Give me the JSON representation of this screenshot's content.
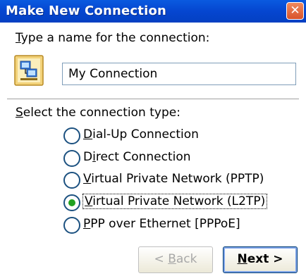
{
  "window": {
    "title": "Make New Connection",
    "close_glyph": "✕"
  },
  "name_section": {
    "prompt": "Type a name for the connection:",
    "prompt_mnemonic": "T",
    "prompt_rest": "ype a name for the connection:",
    "icon": "network-connection-icon",
    "value": "My Connection"
  },
  "type_section": {
    "prompt": "Select the connection type:",
    "prompt_mnemonic": "S",
    "prompt_rest": "elect the connection type:",
    "options": [
      {
        "label": "Dial-Up Connection",
        "pre": "",
        "mnemonic": "D",
        "rest": "ial-Up Connection",
        "selected": false
      },
      {
        "label": "Direct Connection",
        "pre": "D",
        "mnemonic": "i",
        "rest": "rect Connection",
        "selected": false
      },
      {
        "label": "Virtual Private Network (PPTP)",
        "pre": "",
        "mnemonic": "V",
        "rest": "irtual Private Network (PPTP)",
        "selected": false
      },
      {
        "label": "Virtual Private Network (L2TP)",
        "pre": "",
        "mnemonic": "V",
        "rest": "irtual Private Network (L2TP)",
        "selected": true
      },
      {
        "label": "PPP over Ethernet [PPPoE]",
        "pre": "",
        "mnemonic": "P",
        "rest": "PP over Ethernet [PPPoE]",
        "selected": false
      }
    ]
  },
  "buttons": {
    "back": {
      "label": "< Back",
      "pre": "< ",
      "mnemonic": "B",
      "rest": "ack",
      "enabled": false
    },
    "next": {
      "label": "Next >",
      "pre": "",
      "mnemonic": "N",
      "rest": "ext >",
      "enabled": true
    }
  },
  "colors": {
    "titlebar": "#0546d0",
    "close_button": "#d9532a",
    "radio_selected": "#21a121"
  }
}
